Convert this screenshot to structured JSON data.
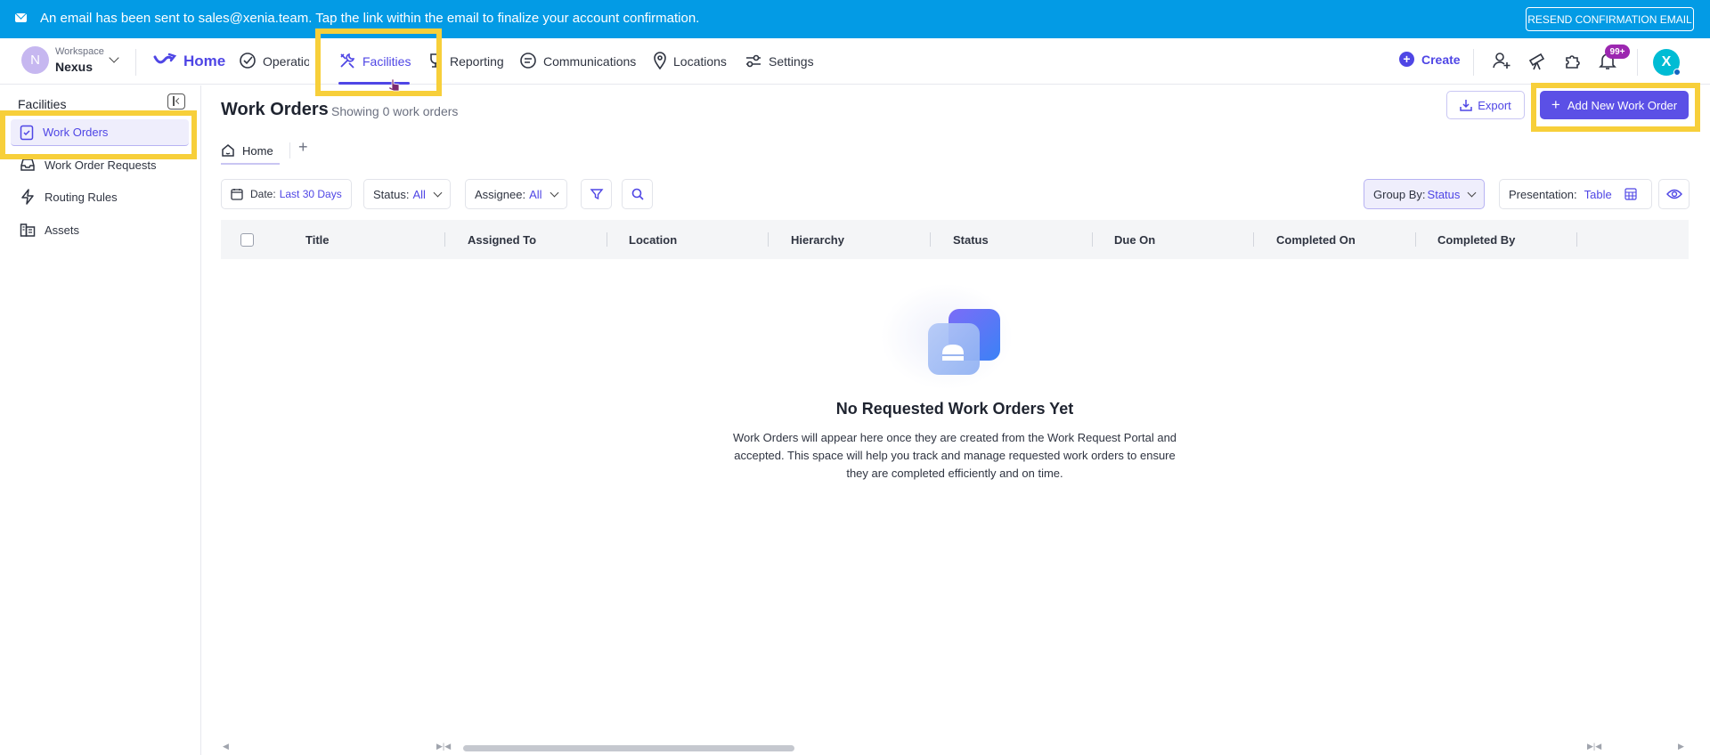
{
  "banner": {
    "message": "An email has been sent to sales@xenia.team. Tap the link within the email to finalize your account confirmation.",
    "resend_label": "RESEND CONFIRMATION EMAIL"
  },
  "workspace": {
    "initial": "N",
    "label": "Workspace",
    "name": "Nexus"
  },
  "nav": {
    "home": "Home",
    "operations": "Operations",
    "facilities": "Facilities",
    "reporting": "Reporting",
    "communications": "Communications",
    "locations": "Locations",
    "settings": "Settings",
    "create": "Create",
    "notifications_badge": "99+",
    "user_initial": "X"
  },
  "sidebar": {
    "title": "Facilities",
    "items": [
      {
        "label": "Work Orders",
        "icon": "work-order-icon"
      },
      {
        "label": "Work Order Requests",
        "icon": "inbox-icon"
      },
      {
        "label": "Routing Rules",
        "icon": "routing-icon"
      },
      {
        "label": "Assets",
        "icon": "assets-icon"
      }
    ]
  },
  "main": {
    "title": "Work Orders",
    "subtitle": "Showing 0 work orders",
    "export_label": "Export",
    "add_label": "Add New Work Order",
    "tabs": [
      {
        "label": "Home"
      }
    ],
    "filters": {
      "date_label": "Date:",
      "date_value": "Last 30 Days",
      "status_label": "Status:",
      "status_value": "All",
      "assignee_label": "Assignee:",
      "assignee_value": "All",
      "groupby_label": "Group By:",
      "groupby_value": "Status",
      "presentation_label": "Presentation:",
      "presentation_value": "Table"
    },
    "columns": [
      "Title",
      "Assigned To",
      "Location",
      "Hierarchy",
      "Status",
      "Due On",
      "Completed On",
      "Completed By"
    ],
    "empty": {
      "title": "No Requested Work Orders Yet",
      "line1": "Work Orders will appear here once they are created from the Work Request Portal and",
      "line2": "accepted. This space will help you track and manage requested work orders to ensure",
      "line3": "they are completed efficiently and on time."
    }
  },
  "colors": {
    "banner": "#039be5",
    "accent": "#4f46e5",
    "highlight": "#f7cf3a",
    "badge": "#9c27b0",
    "user_avatar": "#00bcd4"
  }
}
